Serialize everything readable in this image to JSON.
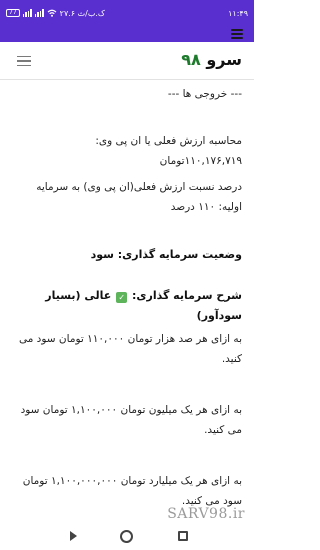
{
  "status_bar": {
    "time": "۱۱:۴۹",
    "network_speed": "۲۷.۶ ک.ب/ث",
    "battery": "77",
    "wifi_icon": "wifi-icon",
    "signal_icon": "signal-icon",
    "background": "#5a2fd0"
  },
  "header": {
    "logo_text": "سرو",
    "logo_number": "۹۸",
    "logo_number_color": "#1e7a2c",
    "menu_icon": "hamburger-icon"
  },
  "content": {
    "outputs_heading": "--- خروجی ها ---",
    "npv_line": "محاسبه ارزش فعلی یا ان پی وی: ۱۱۰,۱۷۶,۷۱۹تومان",
    "npv_percent_line": "درصد نسبت ارزش فعلی(ان پی وی) به سرمایه اولیه: ۱۱۰ درصد",
    "status_heading": "وضعیت سرمایه گذاری: سود",
    "description_prefix": "شرح سرمایه گذاری:",
    "description_suffix": "عالی (بسیار سودآور)",
    "check_emoji_icon": "check-mark-button-icon",
    "per_100k": "به ازای هر صد هزار تومان ۱۱۰,۰۰۰ تومان سود می کنید.",
    "per_1m": "به ازای هر یک میلیون تومان ۱,۱۰۰,۰۰۰ تومان سود می کنید.",
    "per_1b": "به ازای هر یک میلیارد تومان ۱,۱۰۰,۰۰۰,۰۰۰ تومان سود می کنید."
  },
  "watermark": "SARV98.ir",
  "nav_bar": {
    "back_icon": "back-triangle-icon",
    "home_icon": "home-circle-icon",
    "recents_icon": "recents-square-icon"
  }
}
